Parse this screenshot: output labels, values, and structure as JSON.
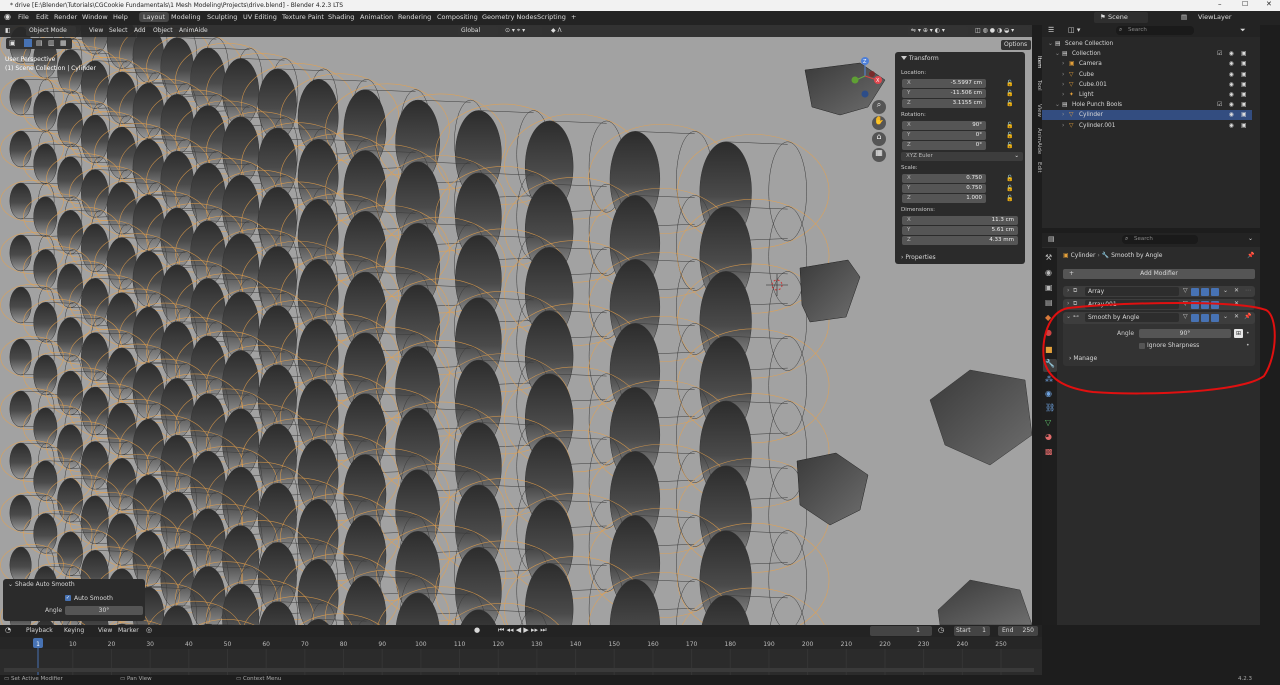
{
  "window": {
    "title": "* drive [E:\\Blender\\Tutorials\\CGCookie Fundamentals\\1 Mesh Modeling\\Projects\\drive.blend] - Blender 4.2.3 LTS",
    "controls": [
      "–",
      "☐",
      "✕"
    ]
  },
  "menu": [
    "File",
    "Edit",
    "Render",
    "Window",
    "Help"
  ],
  "workspaces": [
    "Layout",
    "Modeling",
    "Sculpting",
    "UV Editing",
    "Texture Paint",
    "Shading",
    "Animation",
    "Rendering",
    "Compositing",
    "Geometry Nodes",
    "Scripting"
  ],
  "active_workspace": "Layout",
  "add_workspace": "+",
  "scene": {
    "label": "Scene",
    "view_layer": "ViewLayer"
  },
  "viewport": {
    "mode": "Object Mode",
    "menus": [
      "View",
      "Select",
      "Add",
      "Object",
      "AnimAide"
    ],
    "orientation": "Global",
    "options_label": "Options",
    "overlay_line1": "User Perspective",
    "overlay_line2": "(1) Scene Collection | Cylinder",
    "bg_color": "#a2a2a2",
    "wire_color": "#e8a14a"
  },
  "transform_panel": {
    "title": "Transform",
    "location_label": "Location:",
    "location": [
      "-5.5997 cm",
      "-11.506 cm",
      "3.1155 cm"
    ],
    "rotation_label": "Rotation:",
    "rotation": [
      "90°",
      "0°",
      "0°"
    ],
    "rotation_mode": "XYZ Euler",
    "scale_label": "Scale:",
    "scale": [
      "0.750",
      "0.750",
      "1.000"
    ],
    "dimensions_label": "Dimensions:",
    "dimensions": [
      "11.3 cm",
      "5.61 cm",
      "4.33 mm"
    ],
    "axes": [
      "X",
      "Y",
      "Z"
    ],
    "properties_label": "Properties"
  },
  "side_tabs": [
    "Item",
    "Tool",
    "View",
    "AnimAide",
    "Edit"
  ],
  "auto_smooth_panel": {
    "title": "Shade Auto Smooth",
    "checkbox_label": "Auto Smooth",
    "angle_label": "Angle",
    "angle_value": "30°"
  },
  "timeline": {
    "menus": [
      "Playback",
      "Keying",
      "View",
      "Marker"
    ],
    "current_frame": "1",
    "start_label": "Start",
    "start": "1",
    "end_label": "End",
    "end": "250",
    "ticks": [
      "1",
      "10",
      "20",
      "30",
      "40",
      "50",
      "60",
      "70",
      "80",
      "90",
      "100",
      "110",
      "120",
      "130",
      "140",
      "150",
      "160",
      "170",
      "180",
      "190",
      "200",
      "210",
      "220",
      "230",
      "240",
      "250"
    ]
  },
  "status_bar": {
    "left": "Set Active Modifier",
    "middle": "Pan View",
    "right": "Context Menu",
    "version": "4.2.3"
  },
  "outliner": {
    "search_placeholder": "Search",
    "items": [
      {
        "label": "Scene Collection",
        "depth": 0
      },
      {
        "label": "Collection",
        "depth": 1
      },
      {
        "label": "Camera",
        "depth": 2
      },
      {
        "label": "Cube",
        "depth": 2
      },
      {
        "label": "Cube.001",
        "depth": 2
      },
      {
        "label": "Light",
        "depth": 2
      },
      {
        "label": "Hole Punch Bools",
        "depth": 1
      },
      {
        "label": "Cylinder",
        "depth": 2,
        "selected": true
      },
      {
        "label": "Cylinder.001",
        "depth": 2
      }
    ]
  },
  "properties": {
    "search_placeholder": "Search",
    "breadcrumb_object": "Cylinder",
    "breadcrumb_modifier": "Smooth by Angle",
    "add_modifier": "Add Modifier",
    "modifiers": [
      "Array",
      "Array.001",
      "Smooth by Angle"
    ],
    "angle_label": "Angle",
    "angle_value": "90°",
    "ignore_sharpness": "Ignore Sharpness",
    "manage": "Manage",
    "highlight_color": "#e01010"
  }
}
